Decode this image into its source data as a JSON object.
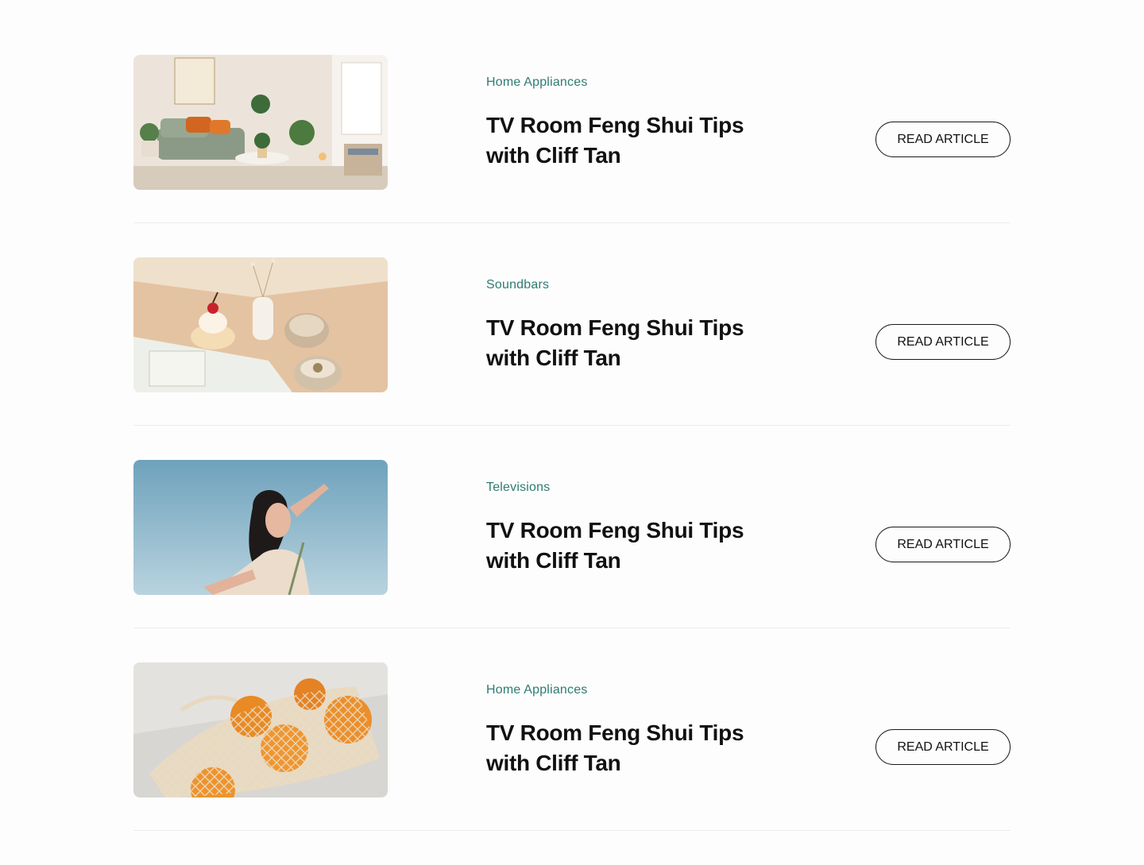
{
  "articles": [
    {
      "category": "Home Appliances",
      "title": "TV Room Feng Shui Tips with Cliff Tan",
      "button_label": "READ ARTICLE",
      "image": "living-room-photo"
    },
    {
      "category": "Soundbars",
      "title": "TV Room Feng Shui Tips with Cliff Tan",
      "button_label": "READ ARTICLE",
      "image": "dessert-and-coffee-photo"
    },
    {
      "category": "Televisions",
      "title": "TV Room Feng Shui Tips with Cliff Tan",
      "button_label": "READ ARTICLE",
      "image": "woman-sky-photo"
    },
    {
      "category": "Home Appliances",
      "title": "TV Room Feng Shui Tips with Cliff Tan",
      "button_label": "READ ARTICLE",
      "image": "oranges-net-bag-photo"
    }
  ],
  "colors": {
    "category": "#2e7c73",
    "title": "#111111",
    "divider": "#ececec",
    "background": "#fdfdfd"
  }
}
